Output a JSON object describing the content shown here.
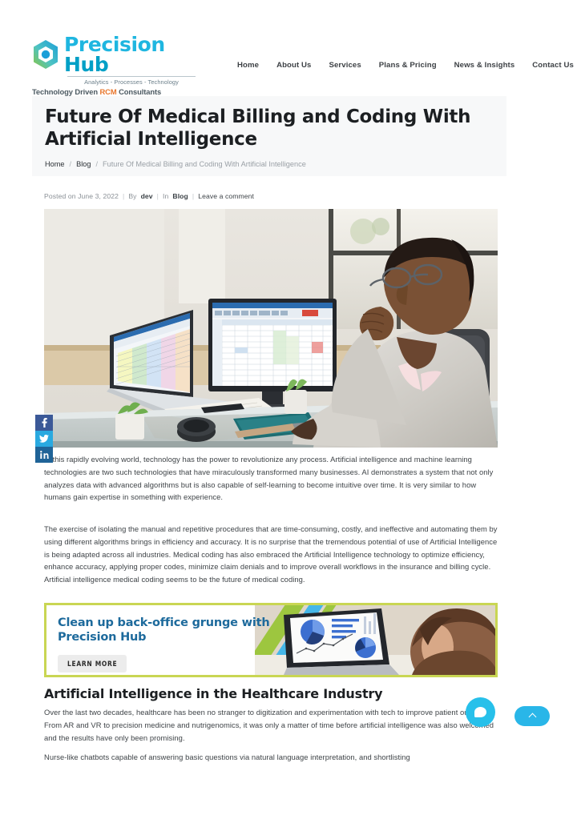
{
  "header": {
    "logo": {
      "word_primary": "Precision",
      "word_secondary": "Hub",
      "tagline_1": "Analytics - Processes - Technology",
      "tagline_2_prefix": "Technology Driven ",
      "tagline_2_accent": "RCM",
      "tagline_2_suffix": " Consultants",
      "mark_color_start": "#8cc63f",
      "mark_color_end": "#29abe2",
      "word_color": "#1fb6e0",
      "accent_color": "#e8762c"
    },
    "nav": [
      {
        "label": "Home"
      },
      {
        "label": "About Us"
      },
      {
        "label": "Services"
      },
      {
        "label": "Plans & Pricing"
      },
      {
        "label": "News & Insights"
      },
      {
        "label": "Contact Us"
      }
    ]
  },
  "title_bar": {
    "title": "Future Of Medical Billing and Coding With Artificial Intelligence",
    "breadcrumb": {
      "home": "Home",
      "blog": "Blog",
      "current": "Future Of Medical Billing and Coding With Artificial Intelligence",
      "separator": "/"
    },
    "background": "#f7f8f9"
  },
  "post_meta": {
    "posted_on": "Posted on June 3, 2022",
    "by_label": "By",
    "author": "dev",
    "in_label": "In",
    "category": "Blog",
    "comment_link": "Leave a comment",
    "separator": "|"
  },
  "share_rail": [
    {
      "name": "facebook",
      "glyph": "f",
      "color": "#3b5998"
    },
    {
      "name": "twitter",
      "glyph": "✈",
      "color": "#29a9e0"
    },
    {
      "name": "linkedin",
      "glyph": "in",
      "color": "#1f6397"
    }
  ],
  "hero_image": {
    "alt": "Man in light grey blazer with glasses reviewing spreadsheets on a monitor and laptop at a glass desk"
  },
  "article": {
    "paragraph_1": "In this rapidly evolving world, technology has the power to revolutionize any process. Artificial intelligence and machine learning technologies are two such technologies that have miraculously transformed many businesses. AI demonstrates a system that not only analyzes data with advanced algorithms but is also capable of self-learning to become intuitive over time. It is very similar to how humans gain expertise in something with experience.",
    "paragraph_2": "The exercise of isolating the manual and repetitive procedures that are time-consuming,   costly, and ineffective and automating them by using different algorithms brings in efficiency and accuracy.  It is no surprise  that the tremendous potential of use of Artificial Intelligence is being adapted across all industries.  Medical coding has also embraced the Artificial Intelligence technology to optimize efficiency, enhance accuracy, applying proper codes, minimize claim denials and to improve overall workflows in the insurance and billing cycle.  Artificial intelligence medical coding seems to be the future of medical coding.",
    "section_heading": "Artificial Intelligence in the Healthcare Industry",
    "paragraph_3": "Over the last two decades, healthcare has been no stranger to digitization and experimentation with tech to improve patient outcomes. From AR and VR to precision medicine and nutrigenomics, it was only a matter of time before artificial intelligence was also welcomed and the results have only been promising.",
    "paragraph_4": "Nurse-like chatbots capable of answering basic questions via natural language interpretation, and shortlisting"
  },
  "promo_banner": {
    "heading": "Clean up back-office grunge with Precision Hub",
    "cta_label": "LEARN MORE",
    "border_color": "#c9d653",
    "heading_color": "#1d6a9c",
    "art_alt": "Woman viewing a laptop screen showing pie charts and a line graph dashboard"
  },
  "widgets": {
    "chat": {
      "label": "chat",
      "color": "#27c0ea"
    },
    "scroll_top": {
      "label": "back to top",
      "color": "#29b6e8"
    }
  }
}
